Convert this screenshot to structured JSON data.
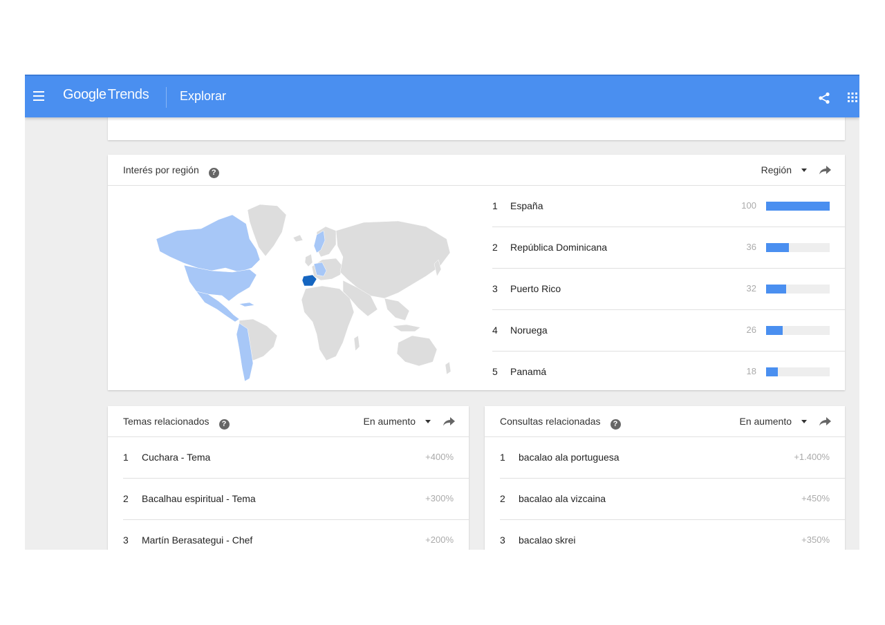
{
  "header": {
    "logo_google": "Google",
    "logo_trends": "Trends",
    "page": "Explorar",
    "icons": [
      "menu-icon",
      "share-icon",
      "apps-icon"
    ]
  },
  "colors": {
    "accent": "#4a8ff0",
    "map_highlight_strong": "#1565c0",
    "map_highlight_light": "#a7c7f7",
    "map_base": "#dddddd"
  },
  "region": {
    "title": "Interés por región",
    "dropdown": "Región",
    "rows": [
      {
        "rank": "1",
        "name": "España",
        "value": "100",
        "fill": 1.0
      },
      {
        "rank": "2",
        "name": "República Dominicana",
        "value": "36",
        "fill": 0.36
      },
      {
        "rank": "3",
        "name": "Puerto Rico",
        "value": "32",
        "fill": 0.32
      },
      {
        "rank": "4",
        "name": "Noruega",
        "value": "26",
        "fill": 0.26
      },
      {
        "rank": "5",
        "name": "Panamá",
        "value": "18",
        "fill": 0.18
      }
    ]
  },
  "topics": {
    "title": "Temas relacionados",
    "dropdown": "En aumento",
    "rows": [
      {
        "rank": "1",
        "name": "Cuchara - Tema",
        "pct": "+400%"
      },
      {
        "rank": "2",
        "name": "Bacalhau espiritual - Tema",
        "pct": "+300%"
      },
      {
        "rank": "3",
        "name": "Martín Berasategui - Chef",
        "pct": "+200%"
      }
    ]
  },
  "queries": {
    "title": "Consultas relacionadas",
    "dropdown": "En aumento",
    "rows": [
      {
        "rank": "1",
        "name": "bacalao ala portuguesa",
        "pct": "+1.400%"
      },
      {
        "rank": "2",
        "name": "bacalao ala vizcaina",
        "pct": "+450%"
      },
      {
        "rank": "3",
        "name": "bacalao skrei",
        "pct": "+350%"
      }
    ]
  }
}
